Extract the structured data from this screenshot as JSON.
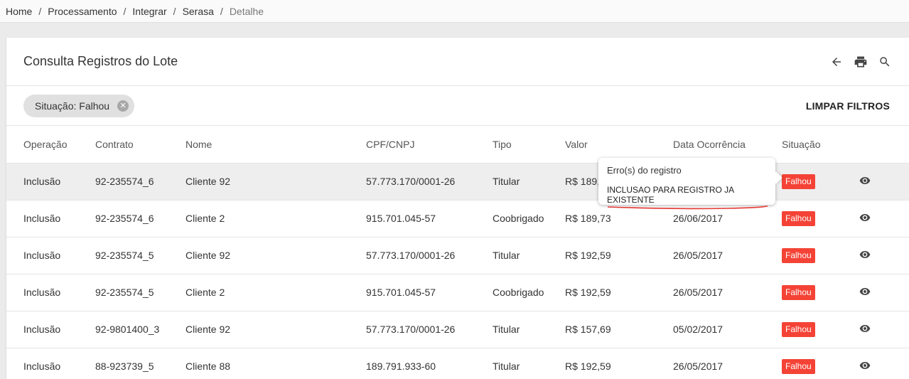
{
  "breadcrumb": [
    "Home",
    "Processamento",
    "Integrar",
    "Serasa",
    "Detalhe"
  ],
  "card": {
    "title": "Consulta Registros do Lote",
    "icons": [
      "arrow-back-icon",
      "print-icon",
      "search-icon"
    ]
  },
  "filters": {
    "chip_label": "Situação: Falhou",
    "clear_label": "LIMPAR FILTROS"
  },
  "table": {
    "columns": [
      "Operação",
      "Contrato",
      "Nome",
      "CPF/CNPJ",
      "Tipo",
      "Valor",
      "Data Ocorrência",
      "Situação"
    ],
    "rows": [
      {
        "operacao": "Inclusão",
        "contrato": "92-235574_6",
        "nome": "Cliente 92",
        "cpf": "57.773.170/0001-26",
        "tipo": "Titular",
        "valor": "R$ 189,73",
        "data": "",
        "situacao": "Falhou"
      },
      {
        "operacao": "Inclusão",
        "contrato": "92-235574_6",
        "nome": "Cliente 2",
        "cpf": "915.701.045-57",
        "tipo": "Coobrigado",
        "valor": "R$ 189,73",
        "data": "26/06/2017",
        "situacao": "Falhou"
      },
      {
        "operacao": "Inclusão",
        "contrato": "92-235574_5",
        "nome": "Cliente 92",
        "cpf": "57.773.170/0001-26",
        "tipo": "Titular",
        "valor": "R$ 192,59",
        "data": "26/05/2017",
        "situacao": "Falhou"
      },
      {
        "operacao": "Inclusão",
        "contrato": "92-235574_5",
        "nome": "Cliente 2",
        "cpf": "915.701.045-57",
        "tipo": "Coobrigado",
        "valor": "R$ 192,59",
        "data": "26/05/2017",
        "situacao": "Falhou"
      },
      {
        "operacao": "Inclusão",
        "contrato": "92-9801400_3",
        "nome": "Cliente 92",
        "cpf": "57.773.170/0001-26",
        "tipo": "Titular",
        "valor": "R$ 157,69",
        "data": "05/02/2017",
        "situacao": "Falhou"
      },
      {
        "operacao": "Inclusão",
        "contrato": "88-923739_5",
        "nome": "Cliente 88",
        "cpf": "189.791.933-60",
        "tipo": "Titular",
        "valor": "R$ 192,59",
        "data": "26/05/2017",
        "situacao": "Falhou"
      }
    ]
  },
  "tooltip": {
    "title": "Erro(s) do registro",
    "message": "INCLUSAO PARA REGISTRO JA EXISTENTE"
  },
  "colors": {
    "badge": "#f44336",
    "selected_row": "#eeeeee",
    "underline": "#e53935"
  }
}
